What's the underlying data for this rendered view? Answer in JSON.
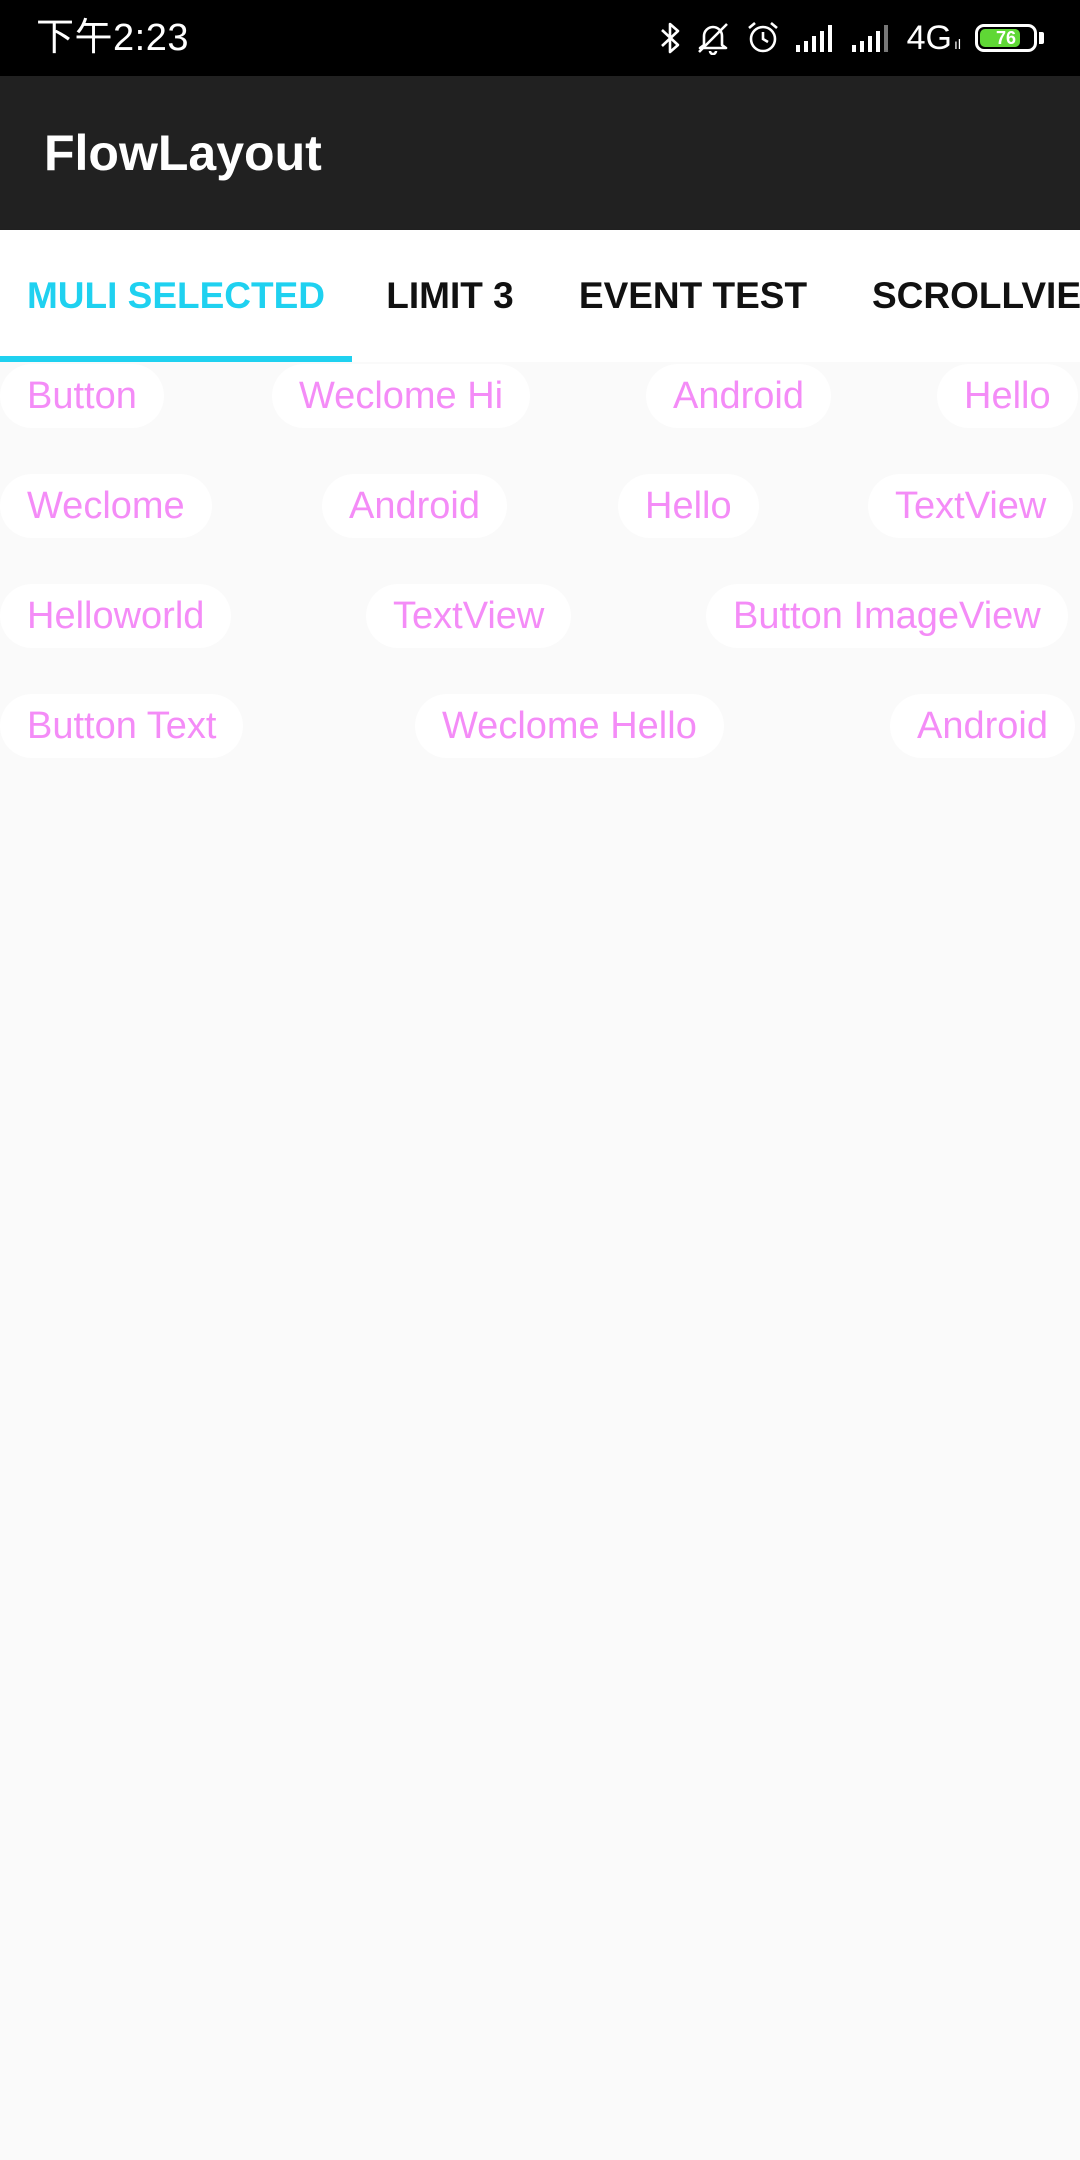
{
  "status_bar": {
    "time": "下午2:23",
    "network_label": "4G",
    "network_sub": "ıl",
    "battery_level": "76",
    "icons": [
      "bluetooth-icon",
      "mute-bell-icon",
      "alarm-icon",
      "signal-icon",
      "signal-icon",
      "battery-icon"
    ]
  },
  "toolbar": {
    "title": "FlowLayout"
  },
  "tabs": [
    {
      "label": "MULI SELECTED",
      "selected": true
    },
    {
      "label": "LIMIT 3",
      "selected": false
    },
    {
      "label": "EVENT TEST",
      "selected": false
    },
    {
      "label": "SCROLLVIEW",
      "selected": false
    }
  ],
  "flow_tags": [
    [
      "Button",
      "Weclome Hi",
      "Android",
      "Hello"
    ],
    [
      "Weclome",
      "Android",
      "Hello",
      "TextView"
    ],
    [
      "Helloworld",
      "TextView",
      "Button ImageView"
    ],
    [
      "Button Text",
      "Weclome Hello",
      "Android"
    ]
  ],
  "colors": {
    "accent": "#1fd1f0",
    "tag_text": "#f48cf7",
    "toolbar_bg": "#212121",
    "status_bar_bg": "#000000",
    "background": "#fafafa"
  }
}
